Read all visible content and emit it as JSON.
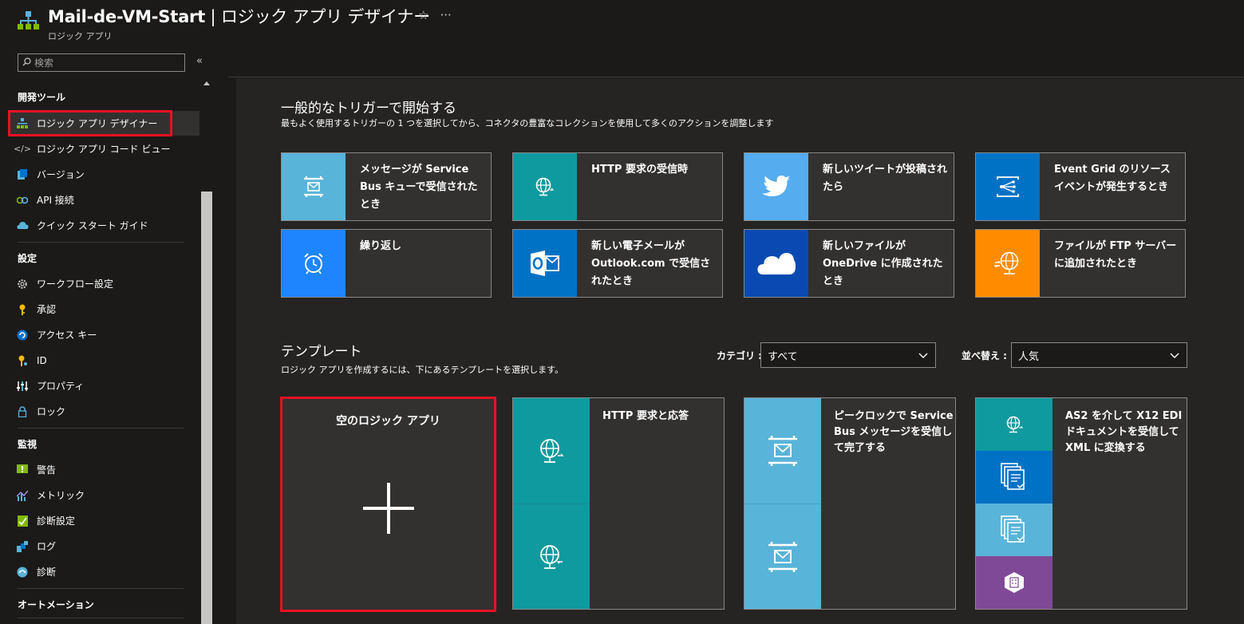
{
  "header": {
    "title_main": "Mail-de-VM-Start",
    "title_sep": " | ",
    "title_page": "ロジック アプリ デザイナー",
    "subtitle": "ロジック アプリ",
    "star": "☆",
    "more": "···"
  },
  "sidebar": {
    "search_placeholder": "検索",
    "collapse": "«",
    "sections": {
      "dev": "開発ツール",
      "settings": "設定",
      "monitor": "監視",
      "automation": "オートメーション"
    },
    "items": {
      "designer": "ロジック アプリ デザイナー",
      "code_view": "ロジック アプリ コード ビュー",
      "versions": "バージョン",
      "api_connections": "API 接続",
      "quickstart": "クイック スタート ガイド",
      "workflow_settings": "ワークフロー設定",
      "authorization": "承認",
      "access_keys": "アクセス キー",
      "id": "ID",
      "properties": "プロパティ",
      "locks": "ロック",
      "alerts": "警告",
      "metrics": "メトリック",
      "diag_settings": "診断設定",
      "logs": "ログ",
      "diagnose": "診断"
    }
  },
  "triggers": {
    "heading": "一般的なトリガーで開始する",
    "description": "最もよく使用するトリガーの 1 つを選択してから、コネクタの豊富なコレクションを使用して多くのアクションを調整します",
    "cards": {
      "servicebus": "メッセージが Service Bus キューで受信されたとき",
      "http": "HTTP 要求の受信時",
      "tweet": "新しいツイートが投稿されたら",
      "eventgrid": "Event Grid のリソース イベントが発生するとき",
      "recurrence": "繰り返し",
      "outlook": "新しい電子メールが Outlook.com で受信されたとき",
      "onedrive": "新しいファイルが OneDrive に作成されたとき",
      "ftp": "ファイルが FTP サーバーに追加されたとき"
    }
  },
  "templates": {
    "heading": "テンプレート",
    "description": "ロジック アプリを作成するには、下にあるテンプレートを選択します。",
    "category_label": "カテゴリ :",
    "category_value": "すべて",
    "sort_label": "並べ替え :",
    "sort_value": "人気",
    "blank": "空のロジック アプリ",
    "http_response": "HTTP 要求と応答",
    "peek_lock": "ピークロックで Service Bus メッセージを受信して完了する",
    "as2": "AS2 を介して X12 EDI ドキュメントを受信して XML に変換する"
  },
  "colors": {
    "teal": "#0f9a9f",
    "light_blue": "#59b4d9",
    "twitter": "#55acee",
    "azure_blue": "#0072c6",
    "recurrence_blue": "#1f85ff",
    "onedrive": "#094ab2",
    "ftp_orange": "#ff8c00",
    "purple": "#804998",
    "highlight_red": "#e81123"
  }
}
